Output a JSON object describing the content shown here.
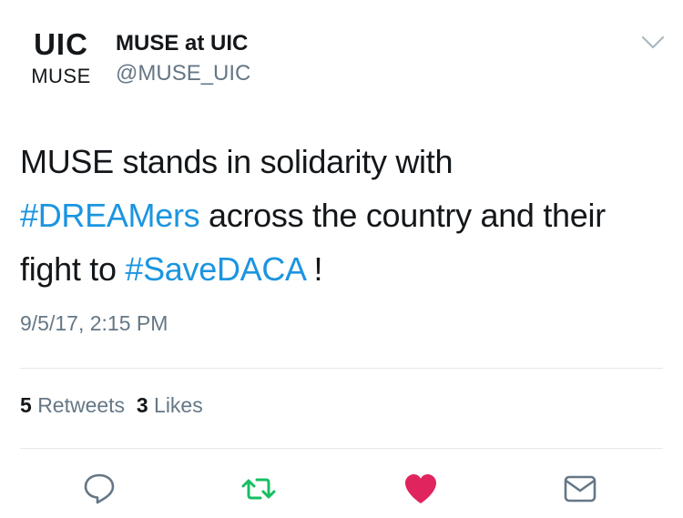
{
  "account": {
    "avatar_logo_top": "UIC",
    "avatar_logo_bottom": "MUSE",
    "display_name": "MUSE at UIC",
    "handle": "@MUSE_UIC"
  },
  "tweet": {
    "text_1": "MUSE stands in solidarity with",
    "hashtag_1": "#DREAMers",
    "text_2": " across the country and their fight to ",
    "hashtag_2": "#SaveDACA",
    "text_3": " !",
    "timestamp": "9/5/17, 2:15 PM"
  },
  "stats": {
    "retweets_count": "5",
    "retweets_label": "Retweets",
    "likes_count": "3",
    "likes_label": "Likes"
  },
  "actions": {
    "reply_icon": "reply-icon",
    "retweet_icon": "retweet-icon",
    "like_icon": "heart-icon",
    "dm_icon": "envelope-icon"
  },
  "colors": {
    "hashtag": "#1b95e0",
    "retweet": "#17bf63",
    "like": "#e0245e",
    "secondary_text": "#657786",
    "divider": "#e1e8ed"
  }
}
